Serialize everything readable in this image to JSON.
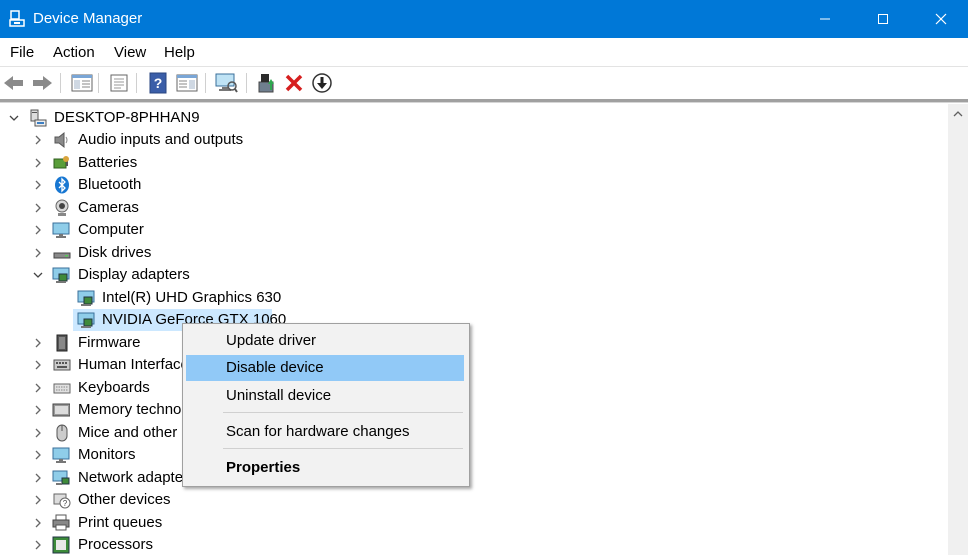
{
  "window": {
    "title": "Device Manager"
  },
  "menubar": {
    "items": [
      "File",
      "Action",
      "View",
      "Help"
    ]
  },
  "toolbar": {
    "buttons": [
      "back-icon",
      "forward-icon",
      "show-hide-console-tree-icon",
      "properties-icon",
      "help-icon",
      "action-pane-icon",
      "scan-hardware-icon",
      "update-driver-icon",
      "uninstall-device-icon",
      "enable-device-icon"
    ]
  },
  "tree": {
    "root": "DESKTOP-8PHHAN9",
    "categories": [
      "Audio inputs and outputs",
      "Batteries",
      "Bluetooth",
      "Cameras",
      "Computer",
      "Disk drives",
      "Display adapters",
      "Firmware",
      "Human Interface",
      "Keyboards",
      "Memory techno",
      "Mice and other p",
      "Monitors",
      "Network adapte",
      "Other devices",
      "Print queues",
      "Processors"
    ],
    "display_adapters_children": [
      "Intel(R) UHD Graphics 630",
      "NVIDIA GeForce GTX 1060"
    ],
    "selected": "NVIDIA GeForce GTX 1060"
  },
  "context_menu": {
    "items": [
      "Update driver",
      "Disable device",
      "Uninstall device",
      "Scan for hardware changes",
      "Properties"
    ],
    "highlighted": "Disable device"
  },
  "colors": {
    "titlebar": "#0078d7",
    "selection": "#cce8ff",
    "menu_highlight": "#91c9f7"
  }
}
